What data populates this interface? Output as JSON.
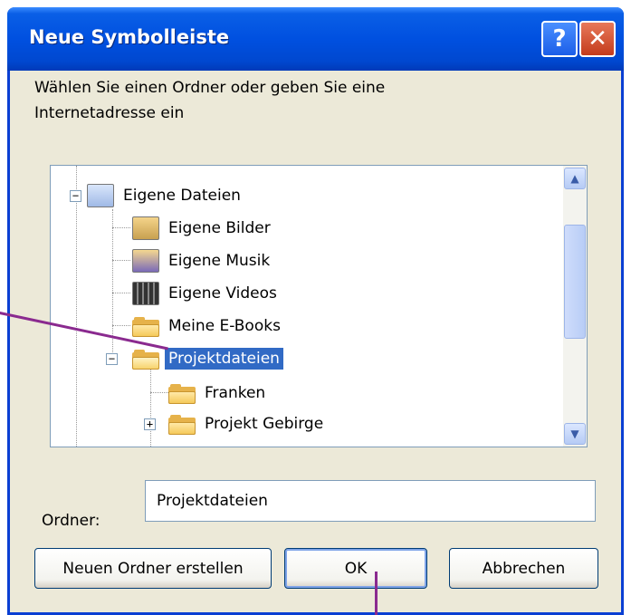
{
  "window": {
    "title": "Neue Symbolleiste",
    "help_glyph": "?",
    "close_glyph": "✕"
  },
  "description": {
    "line1": "Wählen Sie einen Ordner oder geben Sie eine",
    "line2": "Internetadresse ein"
  },
  "tree": {
    "items": [
      {
        "label": "Eigene Dateien",
        "icon": "my-documents-icon",
        "expander": "−"
      },
      {
        "label": "Eigene Bilder",
        "icon": "my-pictures-icon"
      },
      {
        "label": "Eigene Musik",
        "icon": "my-music-icon"
      },
      {
        "label": "Eigene Videos",
        "icon": "my-videos-icon"
      },
      {
        "label": "Meine E-Books",
        "icon": "folder-icon"
      },
      {
        "label": "Projektdateien",
        "icon": "open-folder-icon",
        "expander": "−",
        "selected": true
      },
      {
        "label": "Franken",
        "icon": "folder-icon"
      },
      {
        "label": "Projekt Gebirge",
        "icon": "folder-icon",
        "expander": "+"
      }
    ]
  },
  "scrollbar": {
    "up": "▲",
    "down": "▼"
  },
  "folder_field": {
    "label": "Ordner:",
    "value": "Projektdateien"
  },
  "buttons": {
    "new_folder": "Neuen Ordner erstellen",
    "ok": "OK",
    "cancel": "Abbrechen"
  },
  "colors": {
    "title_bar": "#0050e0",
    "selection": "#316ac5",
    "callout_line": "#8a2a8f"
  }
}
